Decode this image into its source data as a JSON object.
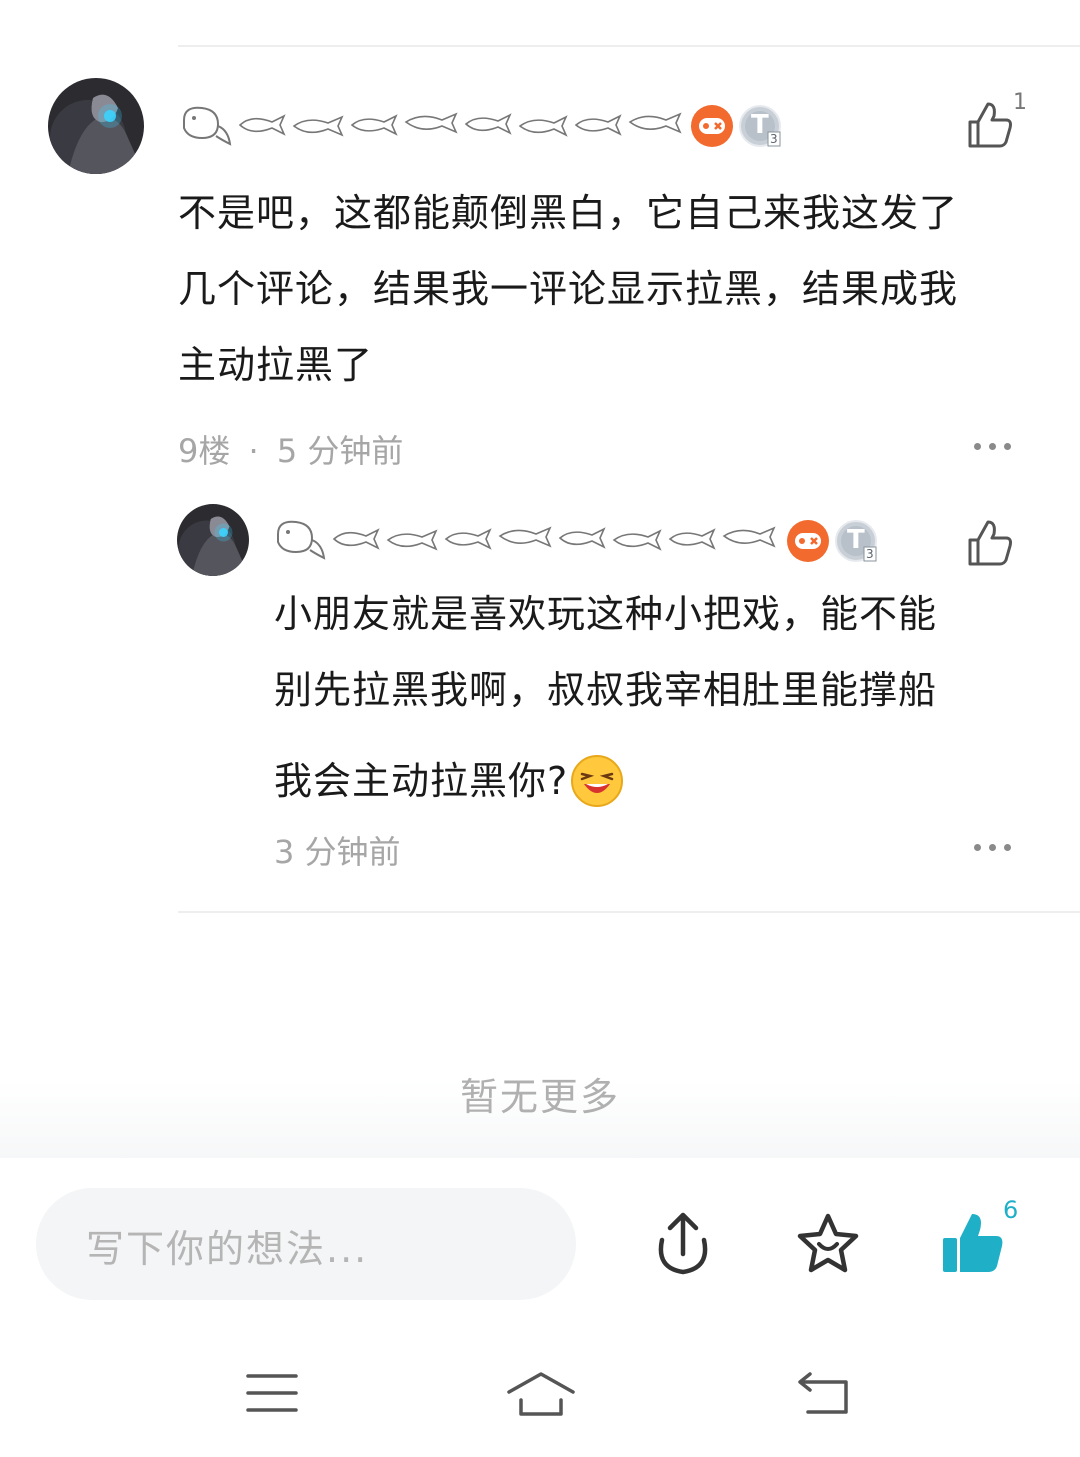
{
  "comment": {
    "like_count": "1",
    "text": "不是吧，这都能颠倒黑白，它自己来我这发了\n几个评论，结果我一评论显示拉黑，结果成我\n主动拉黑了",
    "floor": "9楼",
    "separator": "·",
    "time": "5 分钟前",
    "badges": [
      "game-badge-icon",
      "level-t3-icon"
    ]
  },
  "reply": {
    "text_line1": "小朋友就是喜欢玩这种小把戏，能不能",
    "text_line2": "别先拉黑我啊，叔叔我宰相肚里能撑船",
    "text_line3": "我会主动拉黑你?",
    "time": "3 分钟前",
    "badges": [
      "game-badge-icon",
      "level-t3-icon"
    ]
  },
  "list_end_label": "暂无更多",
  "bottom_bar": {
    "input_placeholder": "写下你的想法...",
    "like_total": "6",
    "accent_color": "#1fb0c8"
  },
  "level_badge_text": "T",
  "level_badge_sub": "3"
}
